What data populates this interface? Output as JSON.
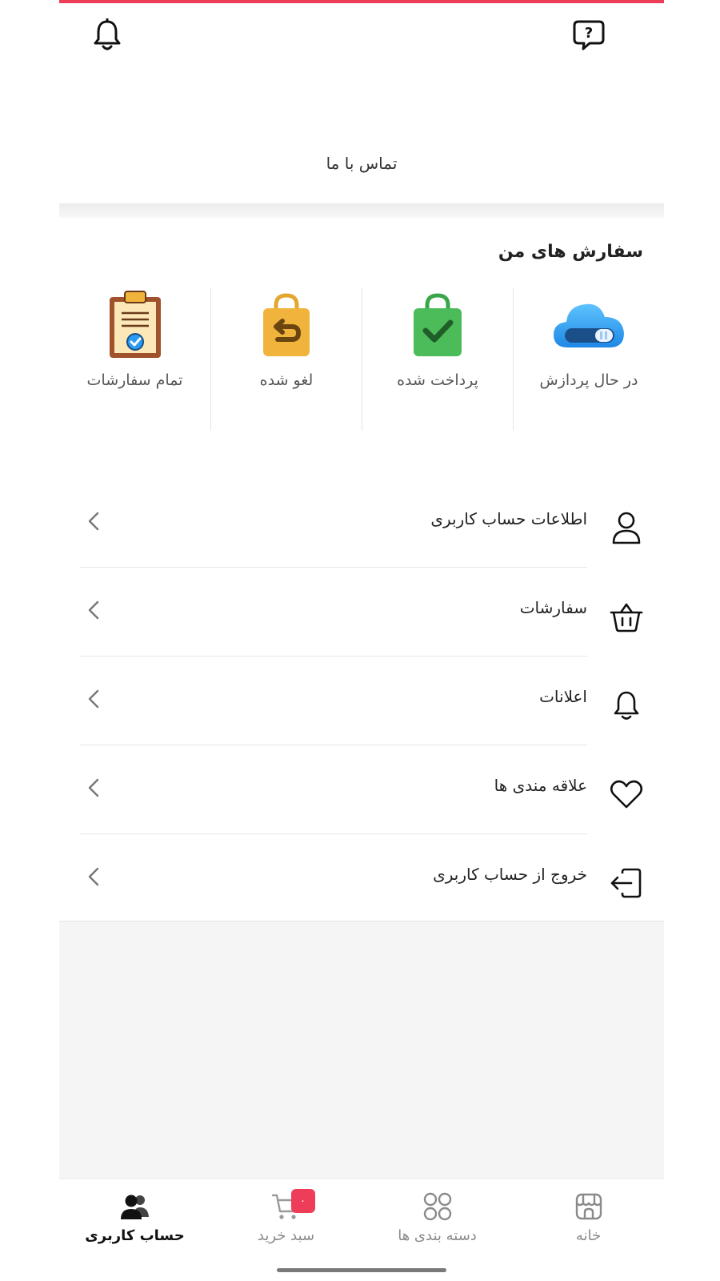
{
  "colors": {
    "accent": "#ee3d59",
    "paid_green": "#4cbb59",
    "cancel_gold": "#f0b43c",
    "cloud_blue": "#2b9bf1",
    "clipboard_brown": "#a0522d"
  },
  "header": {
    "left_icon": "bell-icon",
    "right_icon": "question-chat-icon"
  },
  "contact": {
    "label": "تماس با ما"
  },
  "orders": {
    "title": "سفارش های من",
    "items": [
      {
        "label": "در حال پردازش",
        "icon": "processing-cloud-icon"
      },
      {
        "label": "پرداخت شده",
        "icon": "paid-bag-icon"
      },
      {
        "label": "لغو شده",
        "icon": "cancelled-bag-icon"
      },
      {
        "label": "تمام سفارشات",
        "icon": "clipboard-check-icon"
      }
    ]
  },
  "menu": {
    "items": [
      {
        "label": "اطلاعات حساب کاربری",
        "icon": "user-icon"
      },
      {
        "label": "سفارشات",
        "icon": "basket-icon"
      },
      {
        "label": "اعلانات",
        "icon": "bell-icon"
      },
      {
        "label": "علاقه مندی ها",
        "icon": "heart-icon"
      },
      {
        "label": "خروج از حساب کاربری",
        "icon": "logout-icon"
      }
    ]
  },
  "bottom_nav": {
    "items": [
      {
        "label": "خانه",
        "icon": "shop-icon",
        "active": false
      },
      {
        "label": "دسته بندی ها",
        "icon": "categories-grid-icon",
        "active": false
      },
      {
        "label": "سبد خرید",
        "icon": "cart-icon",
        "active": false,
        "badge": "۰"
      },
      {
        "label": "حساب کاربری",
        "icon": "users-icon",
        "active": true
      }
    ]
  }
}
